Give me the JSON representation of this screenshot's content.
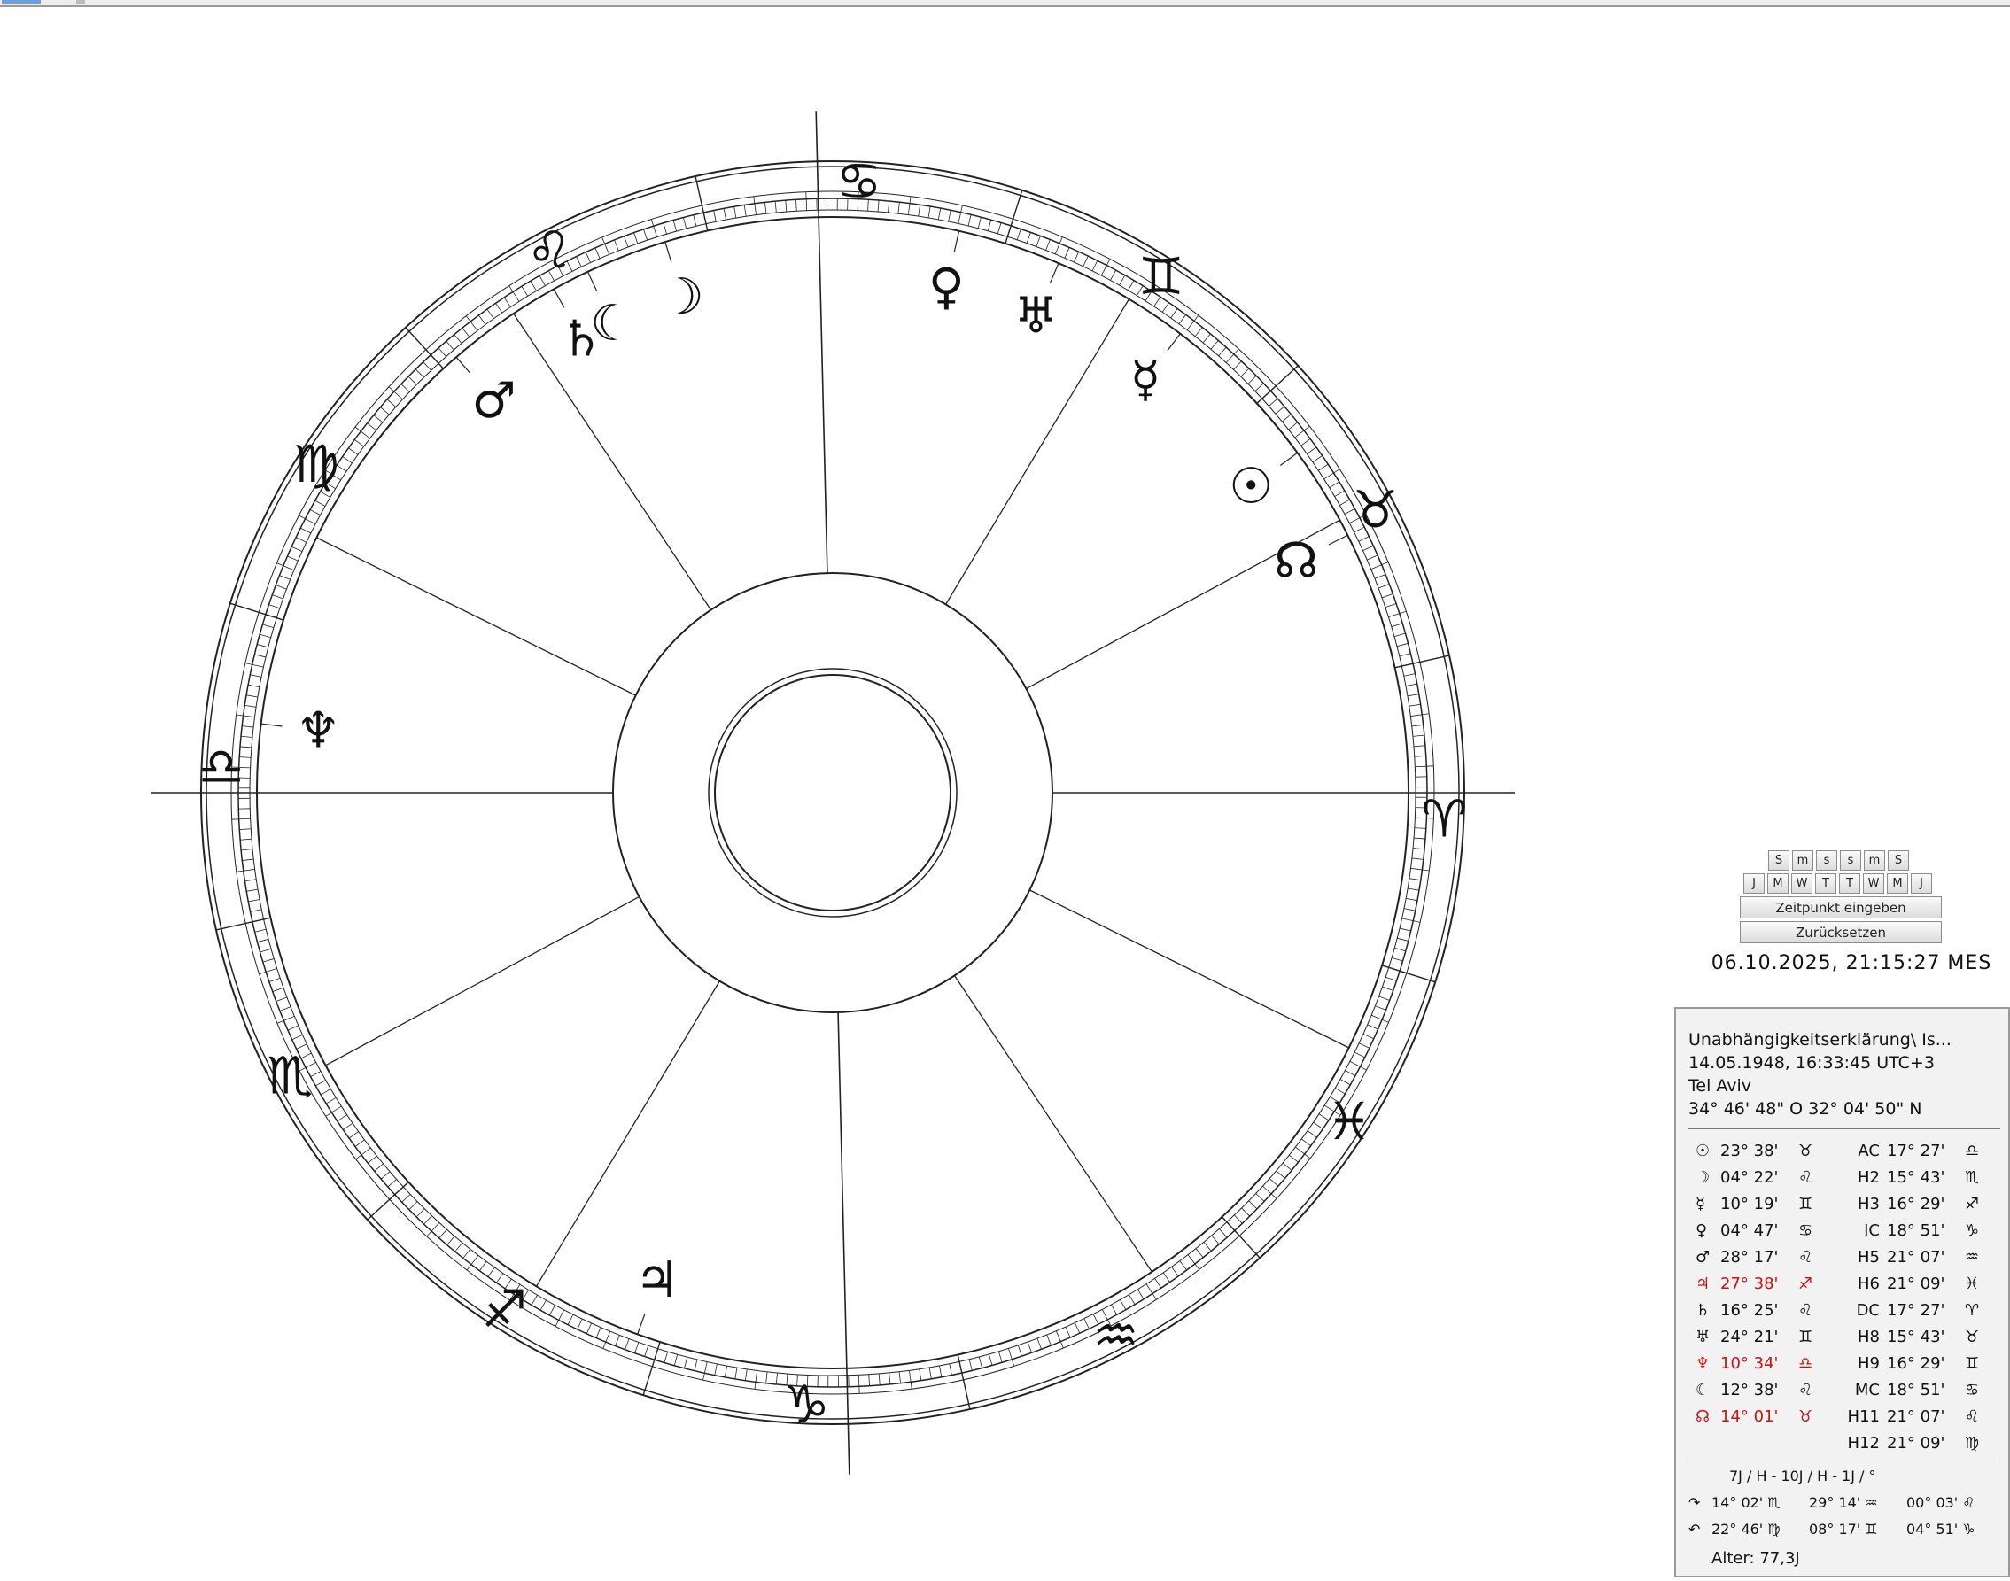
{
  "chart": {
    "signs": [
      {
        "name": "aries",
        "symbol": "♈"
      },
      {
        "name": "taurus",
        "symbol": "♉"
      },
      {
        "name": "gemini",
        "symbol": "♊"
      },
      {
        "name": "cancer",
        "symbol": "♋"
      },
      {
        "name": "leo",
        "symbol": "♌"
      },
      {
        "name": "virgo",
        "symbol": "♍"
      },
      {
        "name": "libra",
        "symbol": "♎"
      },
      {
        "name": "scorpio",
        "symbol": "♏"
      },
      {
        "name": "sagittarius",
        "symbol": "♐"
      },
      {
        "name": "capricorn",
        "symbol": "♑"
      },
      {
        "name": "aquarius",
        "symbol": "♒"
      },
      {
        "name": "pisces",
        "symbol": "♓"
      }
    ],
    "planets": [
      {
        "name": "sun",
        "symbol": "☉",
        "lon": 53.63
      },
      {
        "name": "moon",
        "symbol": "☽",
        "lon": 124.37
      },
      {
        "name": "mercury",
        "symbol": "☿",
        "lon": 70.32
      },
      {
        "name": "venus",
        "symbol": "♀",
        "lon": 94.78
      },
      {
        "name": "mars",
        "symbol": "♂",
        "lon": 148.28
      },
      {
        "name": "jupiter",
        "symbol": "♃",
        "lon": 267.63
      },
      {
        "name": "saturn",
        "symbol": "♄",
        "lon": 136.42
      },
      {
        "name": "uranus",
        "symbol": "♅",
        "lon": 84.35
      },
      {
        "name": "neptune",
        "symbol": "♆",
        "lon": 190.57
      },
      {
        "name": "moon-node",
        "symbol": "☊",
        "lon": 44.02
      },
      {
        "name": "lilith",
        "symbol": "☾",
        "lon": 132.63
      }
    ],
    "cusps": [
      197.45,
      225.72,
      256.48,
      288.85,
      321.12,
      351.15,
      17.45,
      45.72,
      76.48,
      108.85,
      141.12,
      171.15
    ]
  },
  "controls": {
    "row1": [
      "S",
      "m",
      "s",
      "s",
      "m",
      "S"
    ],
    "row2": [
      "J",
      "M",
      "W",
      "T",
      "T",
      "W",
      "M",
      "J"
    ],
    "enter_time": "Zeitpunkt eingeben",
    "reset": "Zurücksetzen",
    "current_time": "06.10.2025,  21:15:27 MES"
  },
  "info": {
    "title": "Unabhängigkeitserklärung\\ Is...",
    "datetime": "14.05.1948,  16:33:45 UTC+3",
    "place": "Tel Aviv",
    "coords": "34° 46' 48\" O   32° 04' 50\" N",
    "planets": [
      {
        "sym": "☉",
        "pos": "23° 38'",
        "sign": "♉",
        "red": false
      },
      {
        "sym": "☽",
        "pos": "04° 22'",
        "sign": "♌",
        "red": false
      },
      {
        "sym": "☿",
        "pos": "10° 19'",
        "sign": "♊",
        "red": false
      },
      {
        "sym": "♀",
        "pos": "04° 47'",
        "sign": "♋",
        "red": false
      },
      {
        "sym": "♂",
        "pos": "28° 17'",
        "sign": "♌",
        "red": false
      },
      {
        "sym": "♃",
        "pos": "27° 38'",
        "sign": "♐",
        "red": true
      },
      {
        "sym": "♄",
        "pos": "16° 25'",
        "sign": "♌",
        "red": false
      },
      {
        "sym": "♅",
        "pos": "24° 21'",
        "sign": "♊",
        "red": false
      },
      {
        "sym": "♆",
        "pos": "10° 34'",
        "sign": "♎",
        "red": true
      },
      {
        "sym": "☾",
        "pos": "12° 38'",
        "sign": "♌",
        "red": false
      },
      {
        "sym": "☊",
        "pos": "14° 01'",
        "sign": "♉",
        "red": true
      }
    ],
    "houses": [
      {
        "label": "AC",
        "pos": "17° 27'",
        "sign": "♎"
      },
      {
        "label": "H2",
        "pos": "15° 43'",
        "sign": "♏"
      },
      {
        "label": "H3",
        "pos": "16° 29'",
        "sign": "♐"
      },
      {
        "label": "IC",
        "pos": "18° 51'",
        "sign": "♑"
      },
      {
        "label": "H5",
        "pos": "21° 07'",
        "sign": "♒"
      },
      {
        "label": "H6",
        "pos": "21° 09'",
        "sign": "♓"
      },
      {
        "label": "DC",
        "pos": "17° 27'",
        "sign": "♈"
      },
      {
        "label": "H8",
        "pos": "15° 43'",
        "sign": "♉"
      },
      {
        "label": "H9",
        "pos": "16° 29'",
        "sign": "♊"
      },
      {
        "label": "MC",
        "pos": "18° 51'",
        "sign": "♋"
      },
      {
        "label": "H11",
        "pos": "21° 07'",
        "sign": "♌"
      },
      {
        "label": "H12",
        "pos": "21° 09'",
        "sign": "♍"
      }
    ],
    "progression_header": "7J / H   -   10J / H   -   1J / °",
    "progressions": [
      {
        "sym": "↷",
        "c1": "14° 02' ♏",
        "c2": "29° 14' ♒",
        "c3": "00° 03' ♌"
      },
      {
        "sym": "↶",
        "c1": "22° 46' ♍",
        "c2": "08° 17' ♊",
        "c3": "04° 51' ♑"
      }
    ],
    "age": "Alter: 77,3J"
  }
}
